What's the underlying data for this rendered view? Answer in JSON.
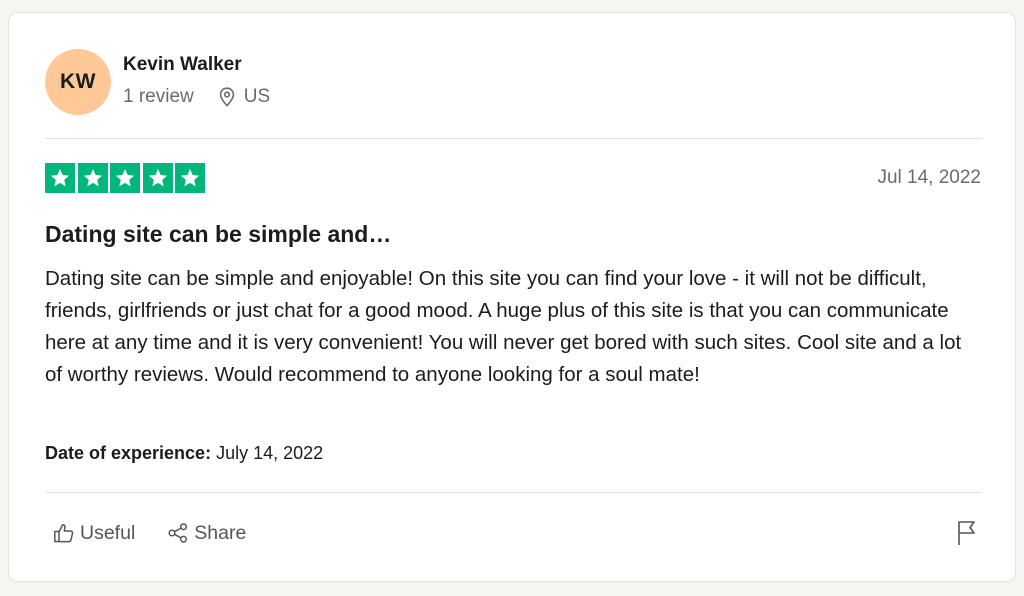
{
  "consumer": {
    "initials": "KW",
    "name": "Kevin Walker",
    "review_count": "1 review",
    "country": "US",
    "avatar_color": "#fec897"
  },
  "review": {
    "rating": 5,
    "rating_max": 5,
    "star_color": "#00b67a",
    "date": "Jul 14, 2022",
    "title": "Dating site can be simple and…",
    "body": "Dating site can be simple and enjoyable! On this site you can find your love - it will not be difficult, friends, girlfriends or just chat for a good mood. A huge plus of this site is that you can communicate here at any time and it is very convenient! You will never get bored with such sites. Cool site and a lot of worthy reviews. Would recommend to anyone looking for a soul mate!",
    "experience_label": "Date of experience:",
    "experience_date": "July 14, 2022"
  },
  "actions": {
    "useful_label": "Useful",
    "share_label": "Share",
    "icons": [
      "thumbs-up-icon",
      "share-icon",
      "flag-icon"
    ]
  }
}
